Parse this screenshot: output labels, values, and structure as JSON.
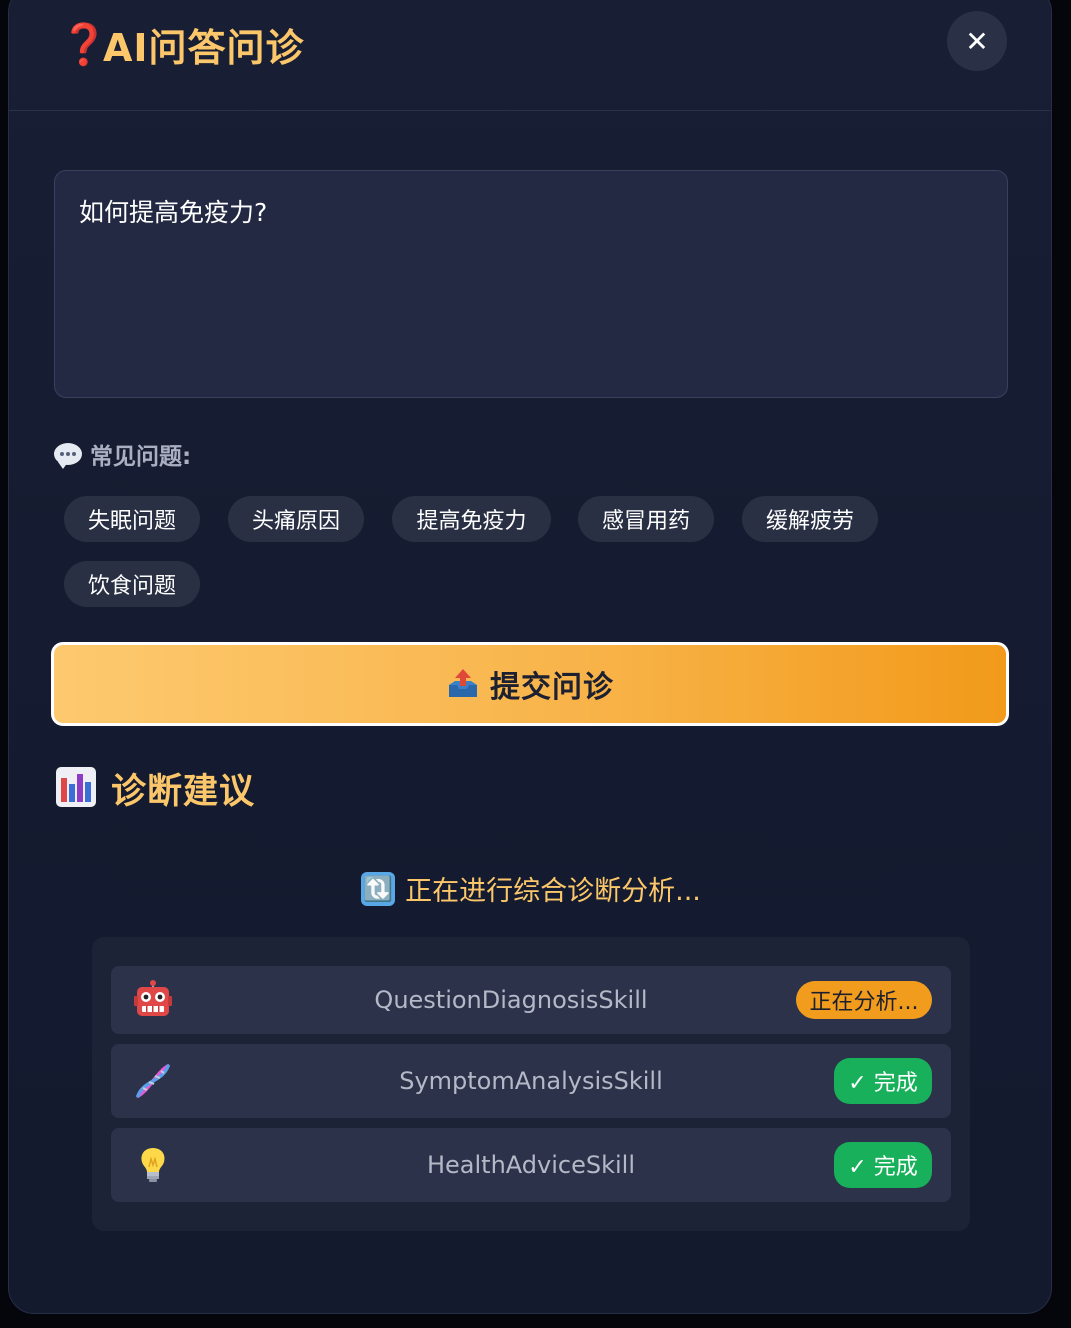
{
  "header": {
    "title_icon": "❓",
    "title": "AI问答问诊",
    "close_label": "✕"
  },
  "question": {
    "value": "如何提高免疫力?"
  },
  "faq": {
    "label": "常见问题:",
    "chips": [
      "失眠问题",
      "头痛原因",
      "提高免疫力",
      "感冒用药",
      "缓解疲劳",
      "饮食问题"
    ]
  },
  "submit": {
    "label": "提交问诊"
  },
  "results": {
    "title": "诊断建议",
    "status_icon": "🔃",
    "status": "正在进行综合诊断分析...",
    "skills": [
      {
        "icon": "robot-icon",
        "name": "QuestionDiagnosisSkill",
        "status": "正在分析..."
      },
      {
        "icon": "dna-icon",
        "name": "SymptomAnalysisSkill",
        "status": "✓ 完成"
      },
      {
        "icon": "lightbulb-icon",
        "name": "HealthAdviceSkill",
        "status": "✓ 完成"
      }
    ]
  },
  "colors": {
    "accent": "#fcc76a",
    "submit_start": "#fdc96f",
    "submit_end": "#f29a1a",
    "progress_badge": "#f29c1e",
    "done_badge": "#18b05a",
    "background": "#151b30"
  }
}
